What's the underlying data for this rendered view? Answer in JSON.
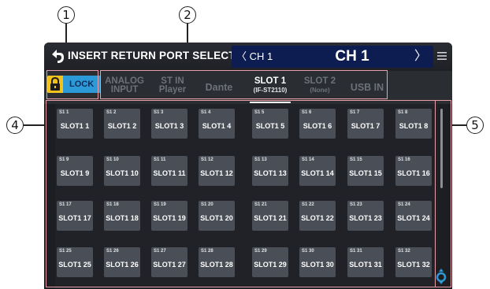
{
  "callouts": [
    "1",
    "2",
    "4",
    "5"
  ],
  "header": {
    "title": "INSERT RETURN PORT SELECT",
    "prev_channel": "CH 1",
    "current_channel": "CH 1",
    "prev_arrow": "〈",
    "next_arrow": "〉"
  },
  "lock_button": {
    "label": "LOCK"
  },
  "tabs": [
    {
      "line1": "ANALOG",
      "line2": "INPUT"
    },
    {
      "line1": "ST IN",
      "line2": "Player"
    },
    {
      "line1": "Dante"
    },
    {
      "line1": "SLOT 1",
      "line2": "(IF-ST2110)"
    },
    {
      "line1": "SLOT 2",
      "line2": "(None)"
    },
    {
      "line1": "USB IN"
    }
  ],
  "active_tab": "SLOT 1",
  "grid": {
    "cells": [
      {
        "num": "S1 1",
        "label": "SLOT1 1"
      },
      {
        "num": "S1 2",
        "label": "SLOT1 2"
      },
      {
        "num": "S1 3",
        "label": "SLOT1 3"
      },
      {
        "num": "S1 4",
        "label": "SLOT1 4"
      },
      {
        "num": "S1 5",
        "label": "SLOT1 5"
      },
      {
        "num": "S1 6",
        "label": "SLOT1 6"
      },
      {
        "num": "S1 7",
        "label": "SLOT1 7"
      },
      {
        "num": "S1 8",
        "label": "SLOT1 8"
      },
      {
        "num": "S1 9",
        "label": "SLOT1 9"
      },
      {
        "num": "S1 10",
        "label": "SLOT1 10"
      },
      {
        "num": "S1 11",
        "label": "SLOT1 11"
      },
      {
        "num": "S1 12",
        "label": "SLOT1 12"
      },
      {
        "num": "S1 13",
        "label": "SLOT1 13"
      },
      {
        "num": "S1 14",
        "label": "SLOT1 14"
      },
      {
        "num": "S1 15",
        "label": "SLOT1 15"
      },
      {
        "num": "S1 16",
        "label": "SLOT1 16"
      },
      {
        "num": "S1 17",
        "label": "SLOT1 17"
      },
      {
        "num": "S1 18",
        "label": "SLOT1 18"
      },
      {
        "num": "S1 19",
        "label": "SLOT1 19"
      },
      {
        "num": "S1 20",
        "label": "SLOT1 20"
      },
      {
        "num": "S1 21",
        "label": "SLOT1 21"
      },
      {
        "num": "S1 22",
        "label": "SLOT1 22"
      },
      {
        "num": "S1 23",
        "label": "SLOT1 23"
      },
      {
        "num": "S1 24",
        "label": "SLOT1 24"
      },
      {
        "num": "S1 25",
        "label": "SLOT1 25"
      },
      {
        "num": "S1 26",
        "label": "SLOT1 26"
      },
      {
        "num": "S1 27",
        "label": "SLOT1 27"
      },
      {
        "num": "S1 28",
        "label": "SLOT1 28"
      },
      {
        "num": "S1 29",
        "label": "SLOT1 29"
      },
      {
        "num": "S1 30",
        "label": "SLOT1 30"
      },
      {
        "num": "S1 31",
        "label": "SLOT1 31"
      },
      {
        "num": "S1 32",
        "label": "SLOT1 32"
      }
    ]
  },
  "colors": {
    "accent_blue": "#2d9ad8",
    "channel_bar": "#0d1d52",
    "lock_yellow": "#f2c21d",
    "highlight_box": "#e9a0a8",
    "cell_bg": "#4a4e56"
  },
  "icons": {
    "back": "back-arrow-icon",
    "menu": "hamburger-menu-icon",
    "lock": "padlock-icon",
    "scroll": "scroll-knob-icon"
  }
}
